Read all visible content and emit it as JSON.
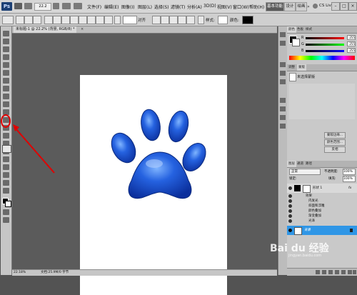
{
  "menubar": {
    "logo": "Ps",
    "zoom_label": "22.2",
    "items": [
      "文件(F)",
      "编辑(E)",
      "图像(I)",
      "图层(L)",
      "选择(S)",
      "滤镜(T)",
      "分析(A)",
      "3D(D)",
      "视图(V)",
      "窗口(W)",
      "帮助(H)"
    ],
    "workspaces": [
      "基本功能",
      "设计",
      "绘画"
    ],
    "cs_live": "CS Live",
    "win_buttons": [
      "–",
      "□",
      "×"
    ]
  },
  "options": {
    "label_style": "样式:",
    "label_color": "颜色:",
    "snap_label": "对齐"
  },
  "document": {
    "tab_label": "未标题-1 @ 22.2% (背景, RGB/8) *",
    "zoom": "22.18%",
    "doc_info": "文档:25.9M/0 字节"
  },
  "colors": {
    "accent_selected": "#2f96e6",
    "paw_fill": "#1a4fd6",
    "highlight_red": "#e00000"
  },
  "color_panel": {
    "tabs": [
      "颜色",
      "色板",
      "样式"
    ],
    "channels": [
      {
        "name": "R",
        "value": "255"
      },
      {
        "name": "G",
        "value": "255"
      },
      {
        "name": "B",
        "value": "255"
      }
    ]
  },
  "adjust_panel": {
    "tabs": [
      "调整",
      "蒙版"
    ],
    "title": "未选择蒙版",
    "buttons": [
      "蒙版边缘...",
      "颜色范围...",
      "反相"
    ]
  },
  "layers_panel": {
    "tabs": [
      "图层",
      "通道",
      "路径"
    ],
    "blend_mode": "正常",
    "opacity_label": "不透明度:",
    "opacity_value": "100%",
    "lock_label": "锁定:",
    "fill_label": "填充:",
    "fill_value": "100%",
    "shape_layer": "形状 1",
    "fx_label": "fx",
    "effects_label": "效果",
    "effects": [
      "内发光",
      "斜面和浮雕",
      "颜色叠加",
      "渐变叠加",
      "光泽"
    ],
    "background_layer": "背景"
  },
  "watermark": "Bai du 经验",
  "watermark_sub": "jingyan.baidu.com"
}
